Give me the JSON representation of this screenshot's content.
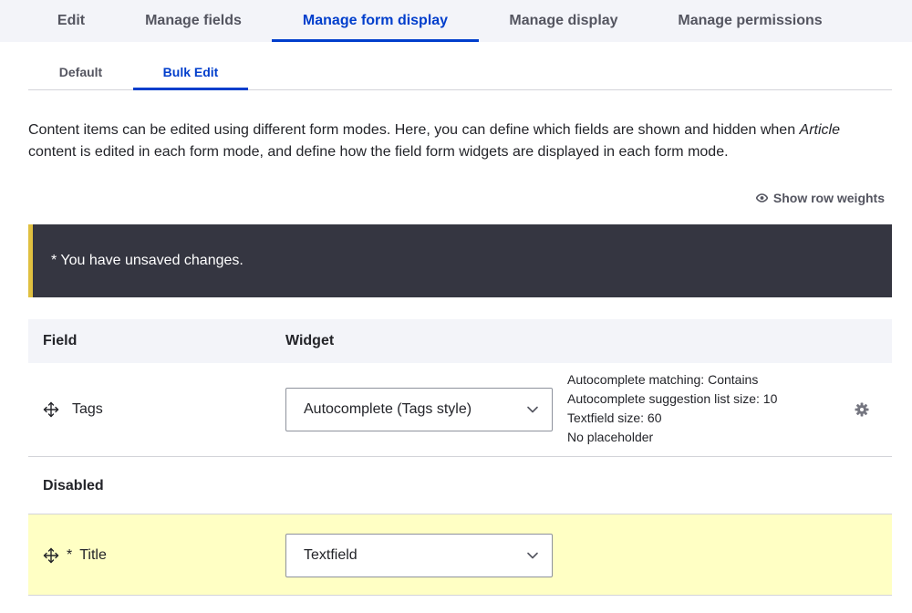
{
  "primary_tabs": [
    {
      "label": "Edit"
    },
    {
      "label": "Manage fields"
    },
    {
      "label": "Manage form display"
    },
    {
      "label": "Manage display"
    },
    {
      "label": "Manage permissions"
    }
  ],
  "secondary_tabs": [
    {
      "label": "Default"
    },
    {
      "label": "Bulk Edit"
    }
  ],
  "description": {
    "part1": "Content items can be edited using different form modes. Here, you can define which fields are shown and hidden when ",
    "em": "Article",
    "part2": " content is edited in each form mode, and define how the field form widgets are displayed in each form mode."
  },
  "row_weights_label": "Show row weights",
  "message": "* You have unsaved changes.",
  "table": {
    "headers": {
      "field": "Field",
      "widget": "Widget"
    },
    "rows": [
      {
        "field": "Tags",
        "widget": "Autocomplete (Tags style)",
        "summary": [
          "Autocomplete matching: Contains",
          "Autocomplete suggestion list size: 10",
          "Textfield size: 60",
          "No placeholder"
        ]
      }
    ],
    "disabled_region": "Disabled",
    "disabled_rows": [
      {
        "required_marker": "*",
        "field": "Title",
        "widget": "Textfield"
      }
    ]
  },
  "colors": {
    "accent": "#003ecc",
    "message_bg": "#353641",
    "message_border": "#e0c040",
    "highlight_row": "#ffffc4"
  },
  "icons": {
    "drag": "move-arrows-icon",
    "eye": "eye-icon",
    "gear": "gear-icon",
    "chevron": "chevron-down-icon"
  }
}
